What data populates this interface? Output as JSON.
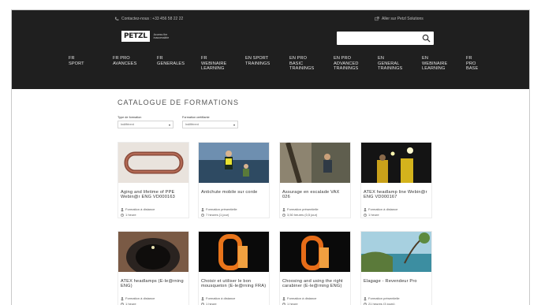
{
  "header": {
    "contact": "Contactez-nous : +33 456 58 22 22",
    "solutions_link": "Aller sur Petzl Solutions",
    "logo": "PETZL",
    "tagline": "Access the inaccessible",
    "search_placeholder": ""
  },
  "nav": [
    {
      "id": "fr-sport",
      "label": "FR\nSPORT"
    },
    {
      "id": "fr-pro-avancees",
      "label": "FR PRO\nAVANCEES"
    },
    {
      "id": "fr-generales",
      "label": "FR\nGENERALES"
    },
    {
      "id": "fr-webinaire",
      "label": "FR\nWEBINAIRE\nLEARNING"
    },
    {
      "id": "en-sport",
      "label": "EN SPORT\nTRAININGS"
    },
    {
      "id": "en-pro-basic",
      "label": "EN PRO\nBASIC\nTRAININGS"
    },
    {
      "id": "en-pro-advanced",
      "label": "EN PRO\nADVANCED\nTRAININGS"
    },
    {
      "id": "en-general",
      "label": "EN\nGENERAL\nTRAININGS"
    },
    {
      "id": "en-webinaire",
      "label": "EN\nWEBINAIRE\nLEARNING"
    },
    {
      "id": "fr-pro-base",
      "label": "FR\nPRO\nBASE"
    }
  ],
  "catalog": {
    "title": "CATALOGUE DE FORMATIONS",
    "filters": [
      {
        "label": "Type de formation",
        "value": "Indifférent"
      },
      {
        "label": "Formation certifiante",
        "value": "Indifférent"
      }
    ]
  },
  "cards": [
    {
      "title": "Aging and lifetime of PPE Webin@r ENG VD000163",
      "type": "Formation à distance",
      "duration": "1 heure",
      "image": "carabiner-photo"
    },
    {
      "title": "Antichute mobile sur corde",
      "type": "Formation présentielle",
      "duration": "7 heures (1 jour)",
      "image": "rope-access-photo"
    },
    {
      "title": "Assurage en escalade VAX 026",
      "type": "Formation présentielle",
      "duration": "3,50 heures (0,5 jour)",
      "image": "climbing-belay-photo"
    },
    {
      "title": "ATEX headlamp line Webin@r ENG VD000167",
      "type": "Formation à distance",
      "duration": "1 heure",
      "image": "headlamp-workers-photo"
    },
    {
      "title": "ATEX headlamps (E-le@rning ENG)",
      "type": "Formation à distance",
      "duration": "1 heure",
      "image": "tunnel-photo"
    },
    {
      "title": "Choisir et utiliser le bon mousqueton (E-le@rning FRA)",
      "type": "Formation à distance",
      "duration": "1 heure",
      "image": "orange-carabiner-photo"
    },
    {
      "title": "Choosing and using the right carabiner (E-le@rning ENG)",
      "type": "Formation à distance",
      "duration": "1 heure",
      "image": "orange-carabiner-photo-2"
    },
    {
      "title": "Elagage - Revendeur Pro",
      "type": "Formation présentielle",
      "duration": "21 heures (3 jours)",
      "image": "tree-coast-photo"
    }
  ]
}
